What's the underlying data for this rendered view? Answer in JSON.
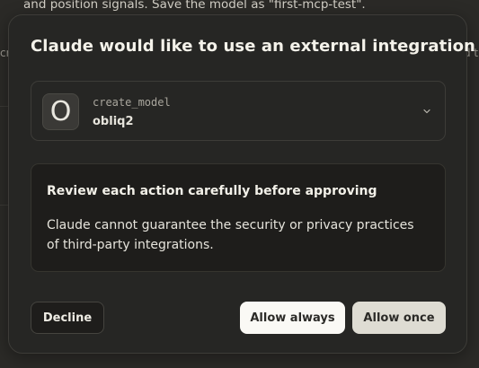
{
  "background": {
    "message_fragment": "and position signals. Save the model as \"first-mcp-test\".",
    "left_edge_fragment": "cr",
    "right_edge_fragment": "d t"
  },
  "dialog": {
    "title": "Claude would like to use an external integration",
    "tool": {
      "avatar_letter": "O",
      "tool_name": "create_model",
      "server_name": "obliq2",
      "expand_icon": "chevron-down-icon"
    },
    "warning": {
      "title": "Review each action carefully before approving",
      "body": "Claude cannot guarantee the security or privacy practices of third-party integrations."
    },
    "buttons": {
      "decline": "Decline",
      "allow_always": "Allow always",
      "allow_once": "Allow once"
    }
  },
  "colors": {
    "dialog_bg": "#262624",
    "primary_button": "#faf9f5",
    "secondary_button": "#dedcd3",
    "text": "#f0eee6"
  }
}
